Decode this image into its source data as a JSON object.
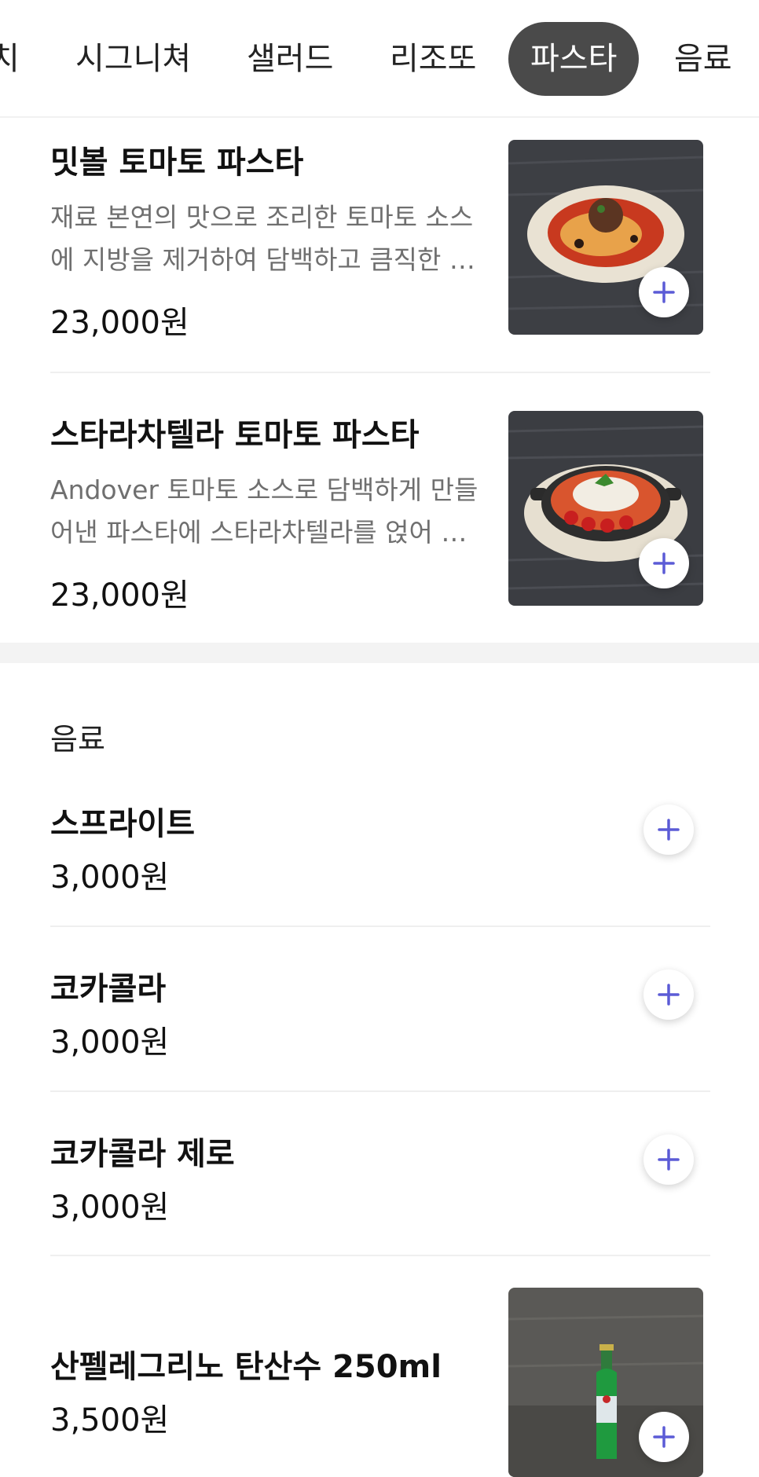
{
  "tabs": [
    {
      "label": "치"
    },
    {
      "label": "시그니쳐"
    },
    {
      "label": "샐러드"
    },
    {
      "label": "리조또"
    },
    {
      "label": "파스타",
      "active": true
    },
    {
      "label": "음료"
    }
  ],
  "pasta_items": [
    {
      "name": "밋볼 토마토 파스타",
      "description": "재료 본연의 맛으로 조리한 토마토 소스에 지방을 제거하여 담백하고 큼직한 밋볼을 올린 파스타",
      "price": "23,000원"
    },
    {
      "name": "스타라차텔라 토마토 파스타",
      "description": "Andover 토마토 소스로 담백하게 만들어낸 파스타에 스타라차텔라를 얹어 부드러운 맛을 더한 파스타",
      "price": "23,000원"
    }
  ],
  "drinks_section": {
    "title": "음료",
    "items": [
      {
        "name": "스프라이트",
        "price": "3,000원"
      },
      {
        "name": "코카콜라",
        "price": "3,000원"
      },
      {
        "name": "코카콜라 제로",
        "price": "3,000원"
      },
      {
        "name": "산펠레그리노 탄산수 250ml",
        "price": "3,500원"
      }
    ]
  },
  "icons": {
    "add": "plus-icon"
  },
  "colors": {
    "accent": "#5b5bd6",
    "active_tab_bg": "#4a4a4a",
    "section_gap": "#f3f3f3"
  }
}
